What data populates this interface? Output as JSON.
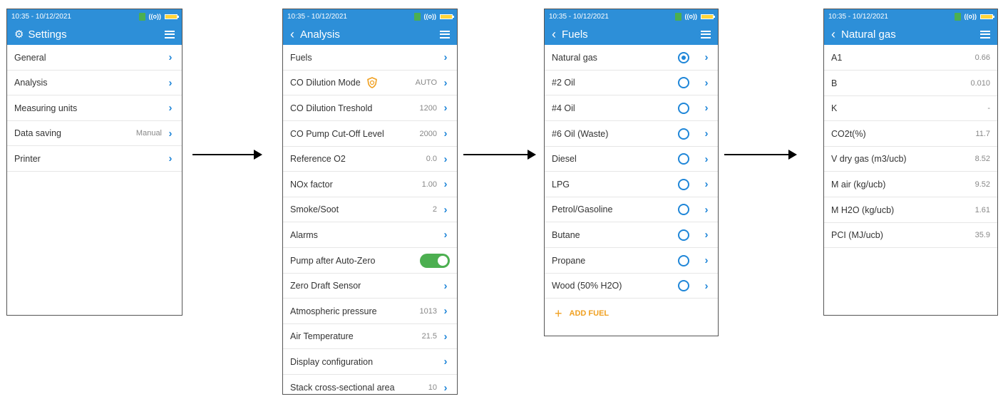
{
  "status": {
    "time": "10:35 - 10/12/2021"
  },
  "screens": {
    "settings": {
      "title": "Settings",
      "items": [
        {
          "label": "General",
          "value": ""
        },
        {
          "label": "Analysis",
          "value": ""
        },
        {
          "label": "Measuring units",
          "value": ""
        },
        {
          "label": "Data saving",
          "value": "Manual"
        },
        {
          "label": "Printer",
          "value": ""
        }
      ]
    },
    "analysis": {
      "title": "Analysis",
      "items": [
        {
          "label": "Fuels",
          "value": ""
        },
        {
          "label": "CO Dilution Mode",
          "value": "AUTO"
        },
        {
          "label": "CO Dilution Treshold",
          "value": "1200"
        },
        {
          "label": "CO Pump Cut-Off Level",
          "value": "2000"
        },
        {
          "label": "Reference O2",
          "value": "0.0"
        },
        {
          "label": "NOx factor",
          "value": "1.00"
        },
        {
          "label": "Smoke/Soot",
          "value": "2"
        },
        {
          "label": "Alarms",
          "value": ""
        },
        {
          "label": "Pump after Auto-Zero",
          "value": ""
        },
        {
          "label": "Zero Draft Sensor",
          "value": ""
        },
        {
          "label": "Atmospheric pressure",
          "value": "1013"
        },
        {
          "label": "Air Temperature",
          "value": "21.5"
        },
        {
          "label": "Display configuration",
          "value": ""
        },
        {
          "label": "Stack cross-sectional area",
          "value": "10"
        }
      ]
    },
    "fuels": {
      "title": "Fuels",
      "items": [
        {
          "label": "Natural gas"
        },
        {
          "label": "#2 Oil"
        },
        {
          "label": "#4 Oil"
        },
        {
          "label": "#6 Oil (Waste)"
        },
        {
          "label": "Diesel"
        },
        {
          "label": "LPG"
        },
        {
          "label": "Petrol/Gasoline"
        },
        {
          "label": "Butane"
        },
        {
          "label": "Propane"
        },
        {
          "label": "Wood (50% H2O)"
        }
      ],
      "add_label": "ADD FUEL"
    },
    "natural_gas": {
      "title": "Natural gas",
      "items": [
        {
          "label": "A1",
          "value": "0.66"
        },
        {
          "label": "B",
          "value": "0.010"
        },
        {
          "label": "K",
          "value": "-"
        },
        {
          "label": "CO2t(%)",
          "value": "11.7"
        },
        {
          "label": "V dry gas (m3/ucb)",
          "value": "8.52"
        },
        {
          "label": "M air (kg/ucb)",
          "value": "9.52"
        },
        {
          "label": "M H2O (kg/ucb)",
          "value": "1.61"
        },
        {
          "label": "PCI (MJ/ucb)",
          "value": "35.9"
        }
      ]
    }
  }
}
